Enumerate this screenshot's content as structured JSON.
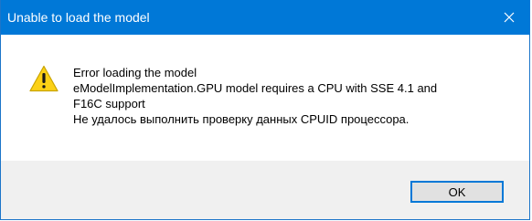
{
  "dialog": {
    "title": "Unable to load the model",
    "close_icon": "close-icon",
    "icon": "warning-icon",
    "message_lines": [
      "Error loading the model",
      "eModelImplementation.GPU model requires a CPU with SSE 4.1 and",
      "F16C support",
      "Не удалось выполнить проверку данных CPUID процессора."
    ],
    "ok_label": "OK"
  },
  "colors": {
    "titlebar": "#0078d7",
    "warning_fill": "#fcd116",
    "button_border": "#0078d7",
    "footer": "#f0f0f0"
  }
}
